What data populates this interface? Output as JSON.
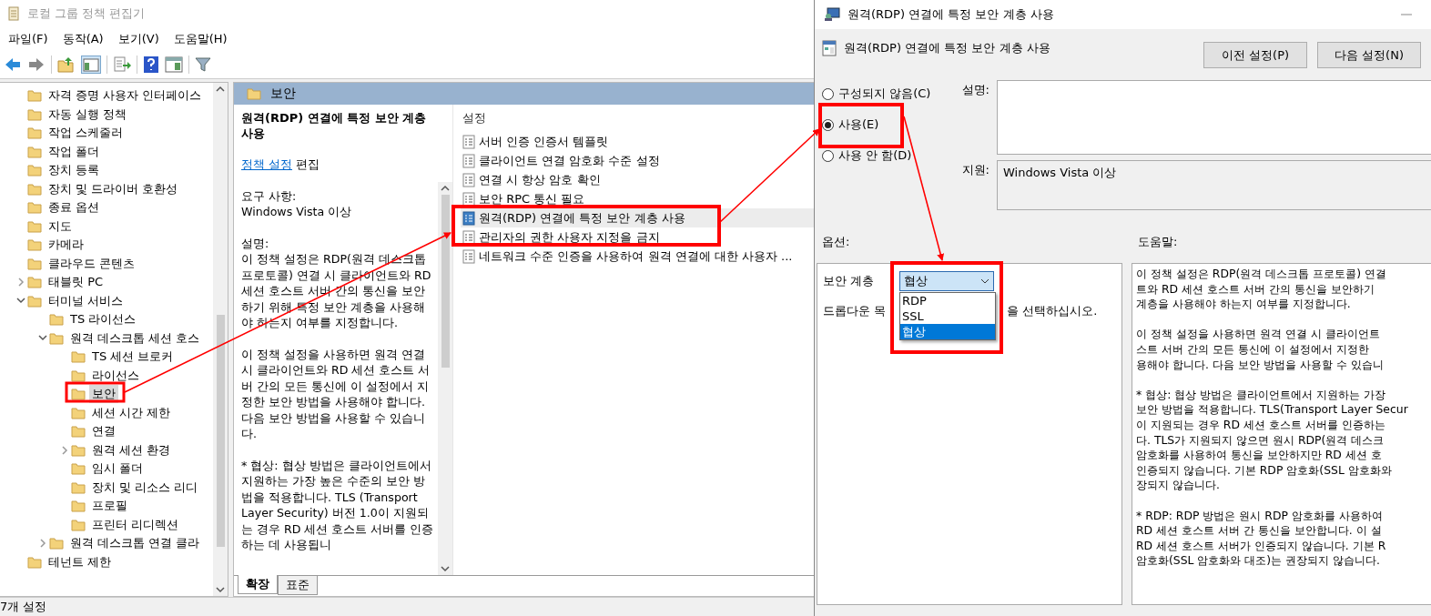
{
  "main_window": {
    "title": "로컬 그룹 정책 편집기",
    "menu": [
      "파일(F)",
      "동작(A)",
      "보기(V)",
      "도움말(H)"
    ],
    "tree": {
      "items": [
        {
          "label": "자격 증명 사용자 인터페이스",
          "selected": false
        },
        {
          "label": "자동 실행 정책",
          "selected": false
        },
        {
          "label": "작업 스케줄러",
          "selected": false
        },
        {
          "label": "작업 폴더",
          "selected": false
        },
        {
          "label": "장치 등록",
          "selected": false
        },
        {
          "label": "장치 및 드라이버 호환성",
          "selected": false
        },
        {
          "label": "종료 옵션",
          "selected": false
        },
        {
          "label": "지도",
          "selected": false
        },
        {
          "label": "카메라",
          "selected": false
        },
        {
          "label": "클라우드 콘텐츠",
          "selected": false
        },
        {
          "label": "태블릿 PC",
          "selected": false,
          "expanded": false
        },
        {
          "label": "터미널 서비스",
          "selected": false,
          "expanded": true,
          "children": [
            {
              "label": "TS 라이선스",
              "selected": false
            },
            {
              "label": "원격 데스크톱 세션 호스",
              "selected": false,
              "expanded": true,
              "children": [
                {
                  "label": "TS 세션 브로커",
                  "selected": false
                },
                {
                  "label": "라이선스",
                  "selected": false
                },
                {
                  "label": "보안",
                  "selected": true
                },
                {
                  "label": "세션 시간 제한",
                  "selected": false
                },
                {
                  "label": "연결",
                  "selected": false
                },
                {
                  "label": "원격 세션 환경",
                  "selected": false,
                  "expanded": false
                },
                {
                  "label": "임시 폴더",
                  "selected": false
                },
                {
                  "label": "장치 및 리소스 리디",
                  "selected": false
                },
                {
                  "label": "프로필",
                  "selected": false
                },
                {
                  "label": "프린터 리디렉션",
                  "selected": false
                }
              ]
            },
            {
              "label": "원격 데스크톱 연결 클라",
              "selected": false,
              "expanded": false
            }
          ]
        },
        {
          "label": "테넌트 제한",
          "selected": false
        }
      ]
    },
    "details": {
      "header": "보안",
      "policy_title": "원격(RDP) 연결에 특정 보안 계층 사용",
      "edit_link": "정책 설정",
      "edit_text": "편집",
      "requirements_label": "요구 사항:",
      "requirements": "Windows Vista 이상",
      "description_label": "설명:",
      "description": [
        "이 정책 설정은 RDP(원격 데스크톱 프로토콜) 연결 시 클라이언트와 RD 세션 호스트 서버 간의 통신을 보안하기 위해 특정 보안 계층을 사용해야 하는지 여부를 지정합니다.",
        "이 정책 설정을 사용하면 원격 연결 시 클라이언트와 RD 세션 호스트 서버 간의 모든 통신에 이 설정에서 지정한 보안 방법을 사용해야 합니다. 다음 보안 방법을 사용할 수 있습니다.",
        "* 협상: 협상 방법은 클라이언트에서 지원하는 가장 높은 수준의 보안 방법을 적용합니다. TLS (Transport Layer Security) 버전 1.0이 지원되는 경우 RD 세션 호스트 서버를 인증하는 데 사용됩니"
      ]
    },
    "settings": {
      "header": "설정",
      "items": [
        {
          "label": "서버 인증 인증서 템플릿",
          "selected": false
        },
        {
          "label": "클라이언트 연결 암호화 수준 설정",
          "selected": false
        },
        {
          "label": "연결 시 항상 암호 확인",
          "selected": false
        },
        {
          "label": "보안 RPC 통신 필요",
          "selected": false
        },
        {
          "label": "원격(RDP) 연결에 특정 보안 계층 사용",
          "selected": true
        },
        {
          "label": "관리자의 권한 사용자 지정을 금지",
          "selected": false
        },
        {
          "label": "네트워크 수준 인증을 사용하여 원격 연결에 대한 사용자 ...",
          "selected": false
        }
      ]
    },
    "tabs": [
      {
        "label": "확장",
        "selected": true
      },
      {
        "label": "표준",
        "selected": false
      }
    ],
    "status_bar": "7개 설정"
  },
  "dialog": {
    "title": "원격(RDP) 연결에 특정 보안 계층 사용",
    "heading": "원격(RDP) 연결에 특정 보안 계층 사용",
    "buttons": [
      "이전 설정(P)",
      "다음 설정(N)"
    ],
    "state_options": [
      {
        "label": "구성되지 않음(C)",
        "selected": false
      },
      {
        "label": "사용(E)",
        "selected": true
      },
      {
        "label": "사용 안 함(D)",
        "selected": false
      }
    ],
    "comment_label": "설명:",
    "supported_label": "지원:",
    "supported": "Windows Vista 이상",
    "options_label": "옵션:",
    "help_label": "도움말:",
    "security_layer": {
      "label": "보안 계층",
      "value": "협상",
      "expanded": true,
      "options": [
        {
          "label": "RDP",
          "selected": false
        },
        {
          "label": "SSL",
          "selected": false
        },
        {
          "label": "협상",
          "selected": true
        }
      ]
    },
    "hint_parts": [
      "드롭다운 목",
      "을 선택하십시오."
    ],
    "help_paragraphs": [
      [
        "이 정책 설정은 RDP(원격 데스크톱 프로토콜) 연결",
        "트와 RD 세션 호스트 서버 간의 통신을 보안하기",
        "계층을 사용해야 하는지 여부를 지정합니다."
      ],
      [
        "이 정책 설정을 사용하면 원격 연결 시 클라이언트",
        "스트 서버 간의 모든 통신에 이 설정에서 지정한",
        "용해야 합니다. 다음 보안 방법을 사용할 수 있습니"
      ],
      [
        "* 협상: 협상 방법은 클라이언트에서 지원하는 가장",
        "보안 방법을 적용합니다. TLS(Transport Layer Secur",
        "이 지원되는 경우 RD 세션 호스트 서버를 인증하는",
        "다. TLS가 지원되지 않으면 원시 RDP(원격 데스크",
        "암호화를 사용하여 통신을 보안하지만 RD 세션 호",
        "인증되지 않습니다. 기본 RDP 암호화(SSL 암호화와",
        "장되지 않습니다."
      ],
      [
        "* RDP: RDP 방법은 원시 RDP 암호화를 사용하여",
        "RD 세션 호스트 서버 간 통신을 보안합니다. 이 설",
        "RD 세션 호스트 서버가 인증되지 않습니다. 기본 R",
        "암호화(SSL 암호화와 대조)는 권장되지 않습니다."
      ]
    ]
  }
}
